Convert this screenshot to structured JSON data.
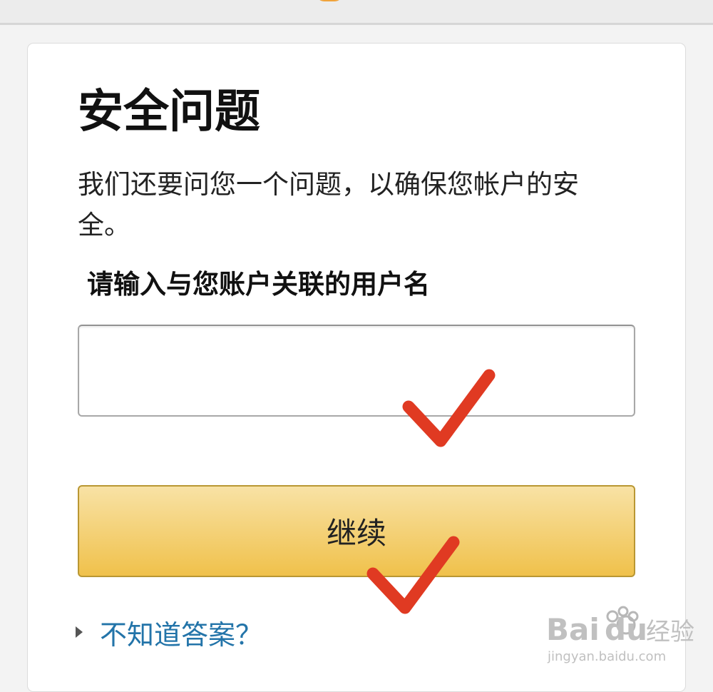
{
  "dialog": {
    "title": "安全问题",
    "description": "我们还要问您一个问题，以确保您帐户的安全。",
    "field_label": "请输入与您账户关联的用户名",
    "input_value": "",
    "input_placeholder": "",
    "continue_label": "继续",
    "help_link": "不知道答案？"
  },
  "annotations": {
    "checkmark_color": "#e03a22",
    "icon": "checkmark-icon"
  },
  "watermark": {
    "brand": "Baidu经验",
    "url": "jingyan.baidu.com"
  },
  "colors": {
    "button_top": "#f8e2a5",
    "button_bottom": "#f0c14b",
    "link": "#2374a9",
    "accent": "#f0a33b"
  }
}
